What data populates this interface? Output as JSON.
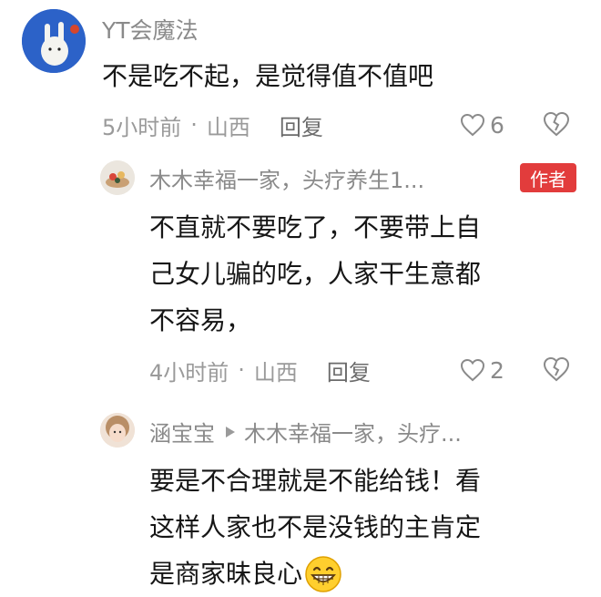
{
  "comments": [
    {
      "user": "YT会魔法",
      "text": "不是吃不起，是觉得值不值吧",
      "time": "5小时前",
      "dot": "·",
      "location": "山西",
      "reply_label": "回复",
      "likes": "6"
    },
    {
      "user": "木木幸福一家，头疗养生1...",
      "badge": "作者",
      "text_lines": [
        "不直就不要吃了，不要带上自",
        "己女儿骗的吃，人家干生意都",
        "不容易，"
      ],
      "time": "4小时前",
      "dot": "·",
      "location": "山西",
      "reply_label": "回复",
      "likes": "2"
    },
    {
      "user": "涵宝宝",
      "reply_to": "木木幸福一家，头疗...",
      "text_lines": [
        "要是不合理就是不能给钱！看",
        "这样人家也不是没钱的主肯定",
        "是商家昧良心"
      ],
      "emoji": "grin-emoji"
    }
  ],
  "colors": {
    "badge": "#e23c3c",
    "meta": "#9a9a9a"
  }
}
